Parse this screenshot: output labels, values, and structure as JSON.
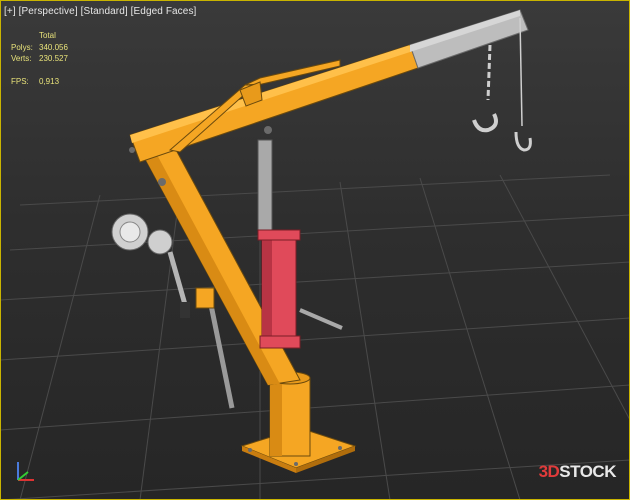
{
  "viewport": {
    "label_parts": [
      "[+]",
      "[Perspective]",
      "[Standard]",
      "[Edged Faces]"
    ],
    "border_color": "#c9b400"
  },
  "stats": {
    "header": "Total",
    "polys_label": "Polys:",
    "polys_value": "340.056",
    "verts_label": "Verts:",
    "verts_value": "230.527",
    "fps_label": "FPS:",
    "fps_value": "0,913"
  },
  "watermark": {
    "prefix": "3D",
    "suffix": "STOCK"
  },
  "colors": {
    "frame": "#f5a623",
    "frame_dark": "#c97d10",
    "boom_extension": "#b8b8b8",
    "cylinder": "#e04a5a",
    "piston": "#a9a9a9"
  },
  "icons": {
    "axis_gizmo": "xyz-axis-icon"
  }
}
